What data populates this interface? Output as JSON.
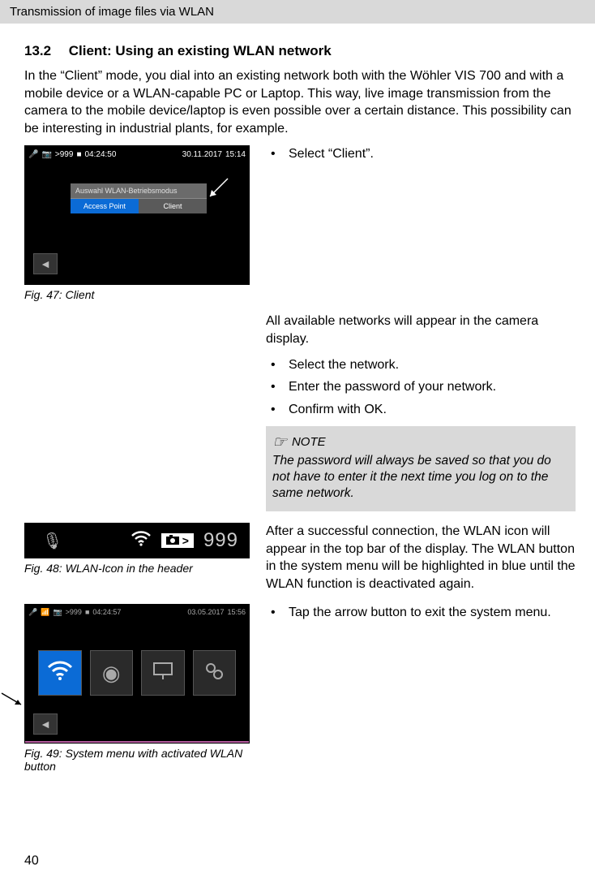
{
  "header": "Transmission of image files via WLAN",
  "section": {
    "number": "13.2",
    "title": "Client: Using an existing WLAN network"
  },
  "intro": "In the “Client” mode, you dial into an existing network both with the Wöhler VIS 700 and with a mobile device or a WLAN-capable PC or Laptop. This way, live image transmission from the camera to the mobile device/laptop is even possible over a certain distance. This possibility can be interesting in industrial plants, for example.",
  "fig47": {
    "caption": "Fig. 47: Client",
    "status_count": ">999",
    "status_rec": "04:24:50",
    "status_date": "30.11.2017",
    "status_time": "15:14",
    "modal_title": "Auswahl WLAN-Betriebsmodus",
    "opt_ap": "Access Point",
    "opt_client": "Client",
    "bullet1": "Select “Client”."
  },
  "block2": {
    "intro": "All available networks will appear in the camera display.",
    "b1": "Select the network.",
    "b2": "Enter the password of your network.",
    "b3": "Confirm with OK."
  },
  "note": {
    "label": "NOTE",
    "body": "The password will always be saved so that you do not have to enter it the next time you log on to the same network."
  },
  "fig48": {
    "caption": "Fig. 48: WLAN-Icon in the header",
    "count_badge": ">",
    "count_value": "999",
    "para": "After a successful connection, the WLAN icon will appear in the top bar of the display. The WLAN button in the system menu will be highlighted in blue until the WLAN function is deactivated again."
  },
  "fig49": {
    "caption": "Fig. 49: System menu with activated WLAN button",
    "status_count": ">999",
    "status_rec": "04:24:57",
    "status_date": "03.05.2017",
    "status_time": "15:56",
    "bullet": "Tap the arrow button to exit the system menu."
  },
  "page": "40"
}
